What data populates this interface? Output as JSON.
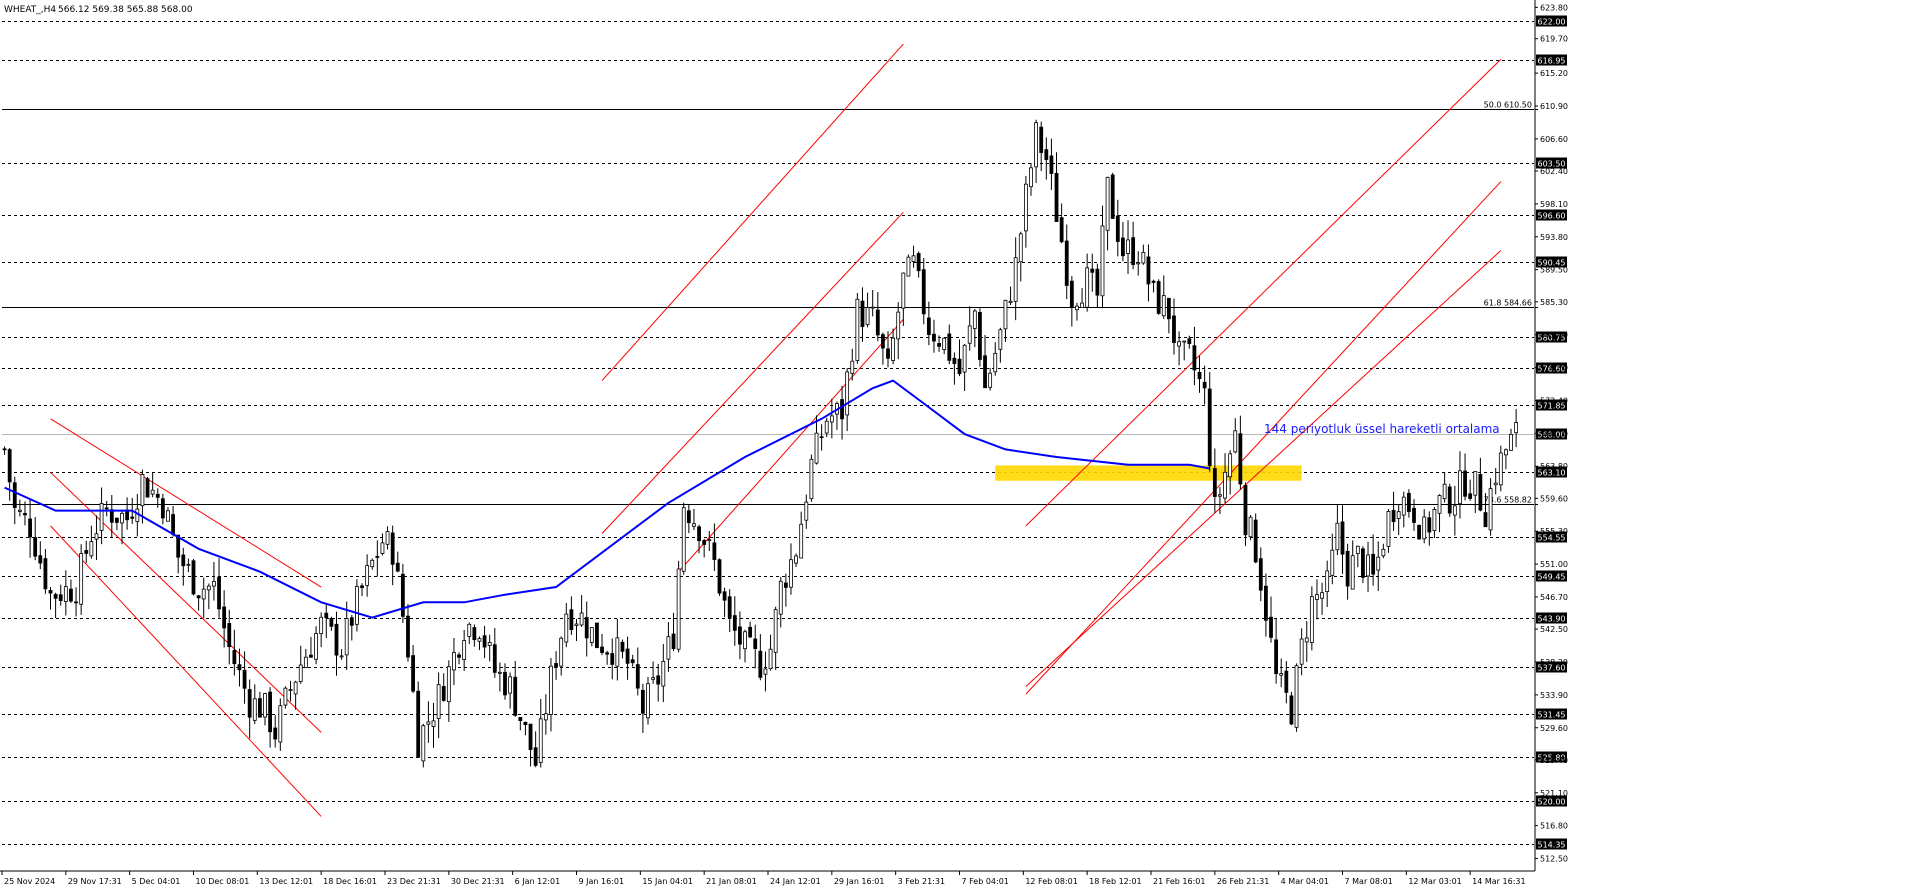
{
  "header": {
    "symbol": "WHEAT_,H4",
    "ohlc": "566.12 569.38 565.88 568.00"
  },
  "colors": {
    "background": "#ffffff",
    "candle": "#000000",
    "ema": "#0000ff",
    "channel": "#ff0000",
    "highlight_zone": "#ffd700",
    "annotation": "#1a1aff",
    "level_badge_bg": "#000000",
    "level_badge_text": "#ffffff"
  },
  "annotations": {
    "ema_label": "144 periyotluk üssel hareketli ortalama"
  },
  "chart_data": {
    "type": "candlestick",
    "symbol": "WHEAT_",
    "timeframe": "H4",
    "ylim": [
      511.0,
      624.5
    ],
    "y_tick_labels": [
      "623.80",
      "619.70",
      "615.20",
      "610.90",
      "606.60",
      "602.40",
      "598.10",
      "593.80",
      "589.50",
      "585.30",
      "581.00",
      "576.70",
      "572.40",
      "568.10",
      "563.80",
      "559.60",
      "555.30",
      "551.00",
      "546.70",
      "542.50",
      "538.20",
      "533.90",
      "529.60",
      "525.40",
      "521.10",
      "516.80",
      "512.50"
    ],
    "x_tick_labels": [
      "25 Nov 2024",
      "29 Nov 17:31",
      "5 Dec 04:01",
      "10 Dec 08:01",
      "13 Dec 12:01",
      "18 Dec 16:01",
      "23 Dec 21:31",
      "30 Dec 21:31",
      "6 Jan 12:01",
      "9 Jan 16:01",
      "15 Jan 04:01",
      "21 Jan 08:01",
      "24 Jan 12:01",
      "29 Jan 16:01",
      "3 Feb 21:31",
      "7 Feb 04:01",
      "12 Feb 08:01",
      "18 Feb 12:01",
      "21 Feb 16:01",
      "26 Feb 21:31",
      "4 Mar 04:01",
      "7 Mar 08:01",
      "12 Mar 03:01",
      "14 Mar 16:31"
    ],
    "horizontal_levels": [
      {
        "price": 622.0,
        "label": "622.00",
        "style": "dashed"
      },
      {
        "price": 616.95,
        "label": "616.95",
        "style": "dashed"
      },
      {
        "price": 610.5,
        "label": "50.0 610.50",
        "style": "solid"
      },
      {
        "price": 603.5,
        "label": "603.50",
        "style": "dashed"
      },
      {
        "price": 596.6,
        "label": "596.60",
        "style": "dashed"
      },
      {
        "price": 590.45,
        "label": "590.45",
        "style": "dashed"
      },
      {
        "price": 584.66,
        "label": "61.8 584.66",
        "style": "solid"
      },
      {
        "price": 580.75,
        "label": "580.75",
        "style": "dashed"
      },
      {
        "price": 576.6,
        "label": "576.60",
        "style": "dashed"
      },
      {
        "price": 571.85,
        "label": "571.85",
        "style": "dashed"
      },
      {
        "price": 568.0,
        "label": "568.00",
        "style": "current"
      },
      {
        "price": 563.1,
        "label": "563.10",
        "style": "dashed"
      },
      {
        "price": 558.82,
        "label": "73.6 558.82",
        "style": "solid"
      },
      {
        "price": 554.55,
        "label": "554.55",
        "style": "dashed"
      },
      {
        "price": 549.45,
        "label": "549.45",
        "style": "dashed"
      },
      {
        "price": 543.9,
        "label": "543.90",
        "style": "dashed"
      },
      {
        "price": 537.6,
        "label": "537.60",
        "style": "dashed"
      },
      {
        "price": 531.45,
        "label": "531.45",
        "style": "dashed"
      },
      {
        "price": 525.8,
        "label": "525.80",
        "style": "dashed"
      },
      {
        "price": 520.0,
        "label": "520.00",
        "style": "dashed"
      },
      {
        "price": 514.35,
        "label": "514.35",
        "style": "dashed"
      }
    ],
    "price_path": [
      [
        0,
        566
      ],
      [
        2,
        558
      ],
      [
        5,
        556
      ],
      [
        9,
        547
      ],
      [
        14,
        548
      ],
      [
        17,
        555
      ],
      [
        20,
        558
      ],
      [
        24,
        557
      ],
      [
        27,
        562
      ],
      [
        31,
        559
      ],
      [
        34,
        552
      ],
      [
        38,
        548
      ],
      [
        41,
        548
      ],
      [
        44,
        540
      ],
      [
        48,
        533
      ],
      [
        51,
        532
      ],
      [
        53,
        529
      ],
      [
        55,
        533
      ],
      [
        58,
        538
      ],
      [
        62,
        543
      ],
      [
        66,
        540
      ],
      [
        69,
        546
      ],
      [
        72,
        551
      ],
      [
        74,
        554
      ],
      [
        76,
        553
      ],
      [
        79,
        540
      ],
      [
        81,
        528
      ],
      [
        84,
        532
      ],
      [
        87,
        537
      ],
      [
        90,
        543
      ],
      [
        93,
        543
      ],
      [
        96,
        537
      ],
      [
        99,
        535
      ],
      [
        102,
        529
      ],
      [
        104,
        525
      ],
      [
        107,
        536
      ],
      [
        110,
        545
      ],
      [
        113,
        544
      ],
      [
        116,
        541
      ],
      [
        119,
        540
      ],
      [
        122,
        538
      ],
      [
        125,
        532
      ],
      [
        128,
        536
      ],
      [
        131,
        542
      ],
      [
        133,
        559
      ],
      [
        136,
        556
      ],
      [
        139,
        551
      ],
      [
        142,
        543
      ],
      [
        145,
        540
      ],
      [
        148,
        538
      ],
      [
        150,
        540
      ],
      [
        152,
        548
      ],
      [
        155,
        553
      ],
      [
        158,
        564
      ],
      [
        161,
        570
      ],
      [
        164,
        571
      ],
      [
        167,
        584
      ],
      [
        170,
        583
      ],
      [
        173,
        576
      ],
      [
        176,
        588
      ],
      [
        178,
        590
      ],
      [
        181,
        582
      ],
      [
        184,
        580
      ],
      [
        187,
        576
      ],
      [
        190,
        584
      ],
      [
        192,
        574
      ],
      [
        195,
        581
      ],
      [
        198,
        590
      ],
      [
        200,
        599
      ],
      [
        202,
        607
      ],
      [
        204,
        604
      ],
      [
        206,
        597
      ],
      [
        209,
        586
      ],
      [
        212,
        588
      ],
      [
        214,
        586
      ],
      [
        216,
        600
      ],
      [
        219,
        592
      ],
      [
        222,
        592
      ],
      [
        225,
        586
      ],
      [
        228,
        584
      ],
      [
        230,
        578
      ],
      [
        232,
        578
      ],
      [
        235,
        573
      ],
      [
        237,
        558
      ],
      [
        239,
        563
      ],
      [
        241,
        568
      ],
      [
        243,
        557
      ],
      [
        245,
        553
      ],
      [
        247,
        545
      ],
      [
        249,
        536
      ],
      [
        252,
        532
      ],
      [
        254,
        540
      ],
      [
        256,
        546
      ],
      [
        259,
        548
      ],
      [
        261,
        555
      ],
      [
        263,
        550
      ],
      [
        265,
        552
      ],
      [
        268,
        549
      ],
      [
        271,
        557
      ],
      [
        273,
        560
      ],
      [
        276,
        558
      ],
      [
        278,
        555
      ],
      [
        281,
        559
      ],
      [
        284,
        560
      ],
      [
        286,
        562
      ],
      [
        288,
        561
      ],
      [
        290,
        558
      ],
      [
        292,
        563
      ],
      [
        294,
        566
      ],
      [
        296,
        568
      ]
    ],
    "ema144": {
      "label": "144 periyotluk üssel hareketli ortalama",
      "points": [
        [
          0,
          561
        ],
        [
          10,
          558
        ],
        [
          25,
          558
        ],
        [
          38,
          553
        ],
        [
          50,
          550
        ],
        [
          62,
          546
        ],
        [
          72,
          544
        ],
        [
          82,
          546
        ],
        [
          90,
          546
        ],
        [
          98,
          547
        ],
        [
          108,
          548
        ],
        [
          118,
          553
        ],
        [
          130,
          559
        ],
        [
          145,
          565
        ],
        [
          160,
          570
        ],
        [
          170,
          574
        ],
        [
          174,
          575
        ],
        [
          180,
          572
        ],
        [
          188,
          568
        ],
        [
          196,
          566
        ],
        [
          206,
          565
        ],
        [
          220,
          564
        ],
        [
          232,
          564
        ],
        [
          236,
          563.5
        ]
      ]
    },
    "channels": [
      {
        "name": "Dec descending",
        "lines": [
          [
            [
              9,
              570
            ],
            [
              62,
              548
            ]
          ],
          [
            [
              9,
              563
            ],
            [
              62,
              529
            ]
          ],
          [
            [
              9,
              556
            ],
            [
              62,
              518
            ]
          ]
        ]
      },
      {
        "name": "Feb ascending",
        "lines": [
          [
            [
              117,
              575
            ],
            [
              176,
              619
            ]
          ],
          [
            [
              117,
              555
            ],
            [
              176,
              597
            ]
          ],
          [
            [
              132,
              550
            ],
            [
              176,
              583
            ]
          ]
        ]
      },
      {
        "name": "Mar ascending",
        "lines": [
          [
            [
              200,
              556
            ],
            [
              293,
              617
            ]
          ],
          [
            [
              200,
              534
            ],
            [
              293,
              601
            ]
          ],
          [
            [
              200,
              535
            ],
            [
              293,
              592
            ]
          ]
        ]
      }
    ],
    "highlight_zone": {
      "x_from": 194,
      "x_to": 254,
      "price_low": 561.9,
      "price_high": 563.9
    }
  }
}
